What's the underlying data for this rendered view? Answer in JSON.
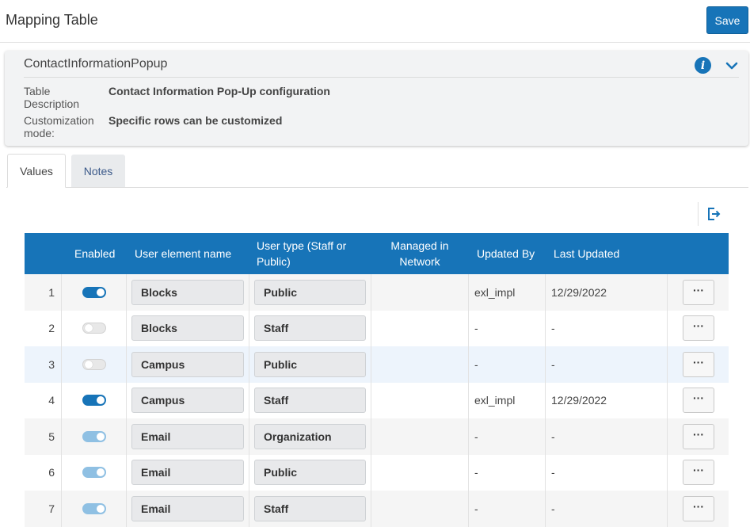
{
  "header": {
    "title": "Mapping Table",
    "save_label": "Save"
  },
  "panel": {
    "title": "ContactInformationPopup",
    "fields": [
      {
        "label": "Table Description",
        "value": "Contact Information Pop-Up configuration"
      },
      {
        "label": "Customization mode:",
        "value": "Specific rows can be customized"
      }
    ]
  },
  "tabs": [
    {
      "label": "Values",
      "active": true
    },
    {
      "label": "Notes",
      "active": false
    }
  ],
  "table": {
    "columns": {
      "enabled": "Enabled",
      "user_element_name": "User element name",
      "user_type": "User type (Staff or Public)",
      "managed_in_network": "Managed in Network",
      "updated_by": "Updated By",
      "last_updated": "Last Updated"
    },
    "rows": [
      {
        "num": "1",
        "enabled": "on",
        "element": "Blocks",
        "type": "Public",
        "managed": "",
        "updated_by": "exl_impl",
        "last_updated": "12/29/2022",
        "actions": "···"
      },
      {
        "num": "2",
        "enabled": "off",
        "element": "Blocks",
        "type": "Staff",
        "managed": "",
        "updated_by": "-",
        "last_updated": "-",
        "actions": "···"
      },
      {
        "num": "3",
        "enabled": "off",
        "element": "Campus",
        "type": "Public",
        "managed": "",
        "updated_by": "-",
        "last_updated": "-",
        "actions": "···"
      },
      {
        "num": "4",
        "enabled": "on",
        "element": "Campus",
        "type": "Staff",
        "managed": "",
        "updated_by": "exl_impl",
        "last_updated": "12/29/2022",
        "actions": "···"
      },
      {
        "num": "5",
        "enabled": "on-disabled",
        "element": "Email",
        "type": "Organization",
        "managed": "",
        "updated_by": "-",
        "last_updated": "-",
        "actions": "···"
      },
      {
        "num": "6",
        "enabled": "on-disabled",
        "element": "Email",
        "type": "Public",
        "managed": "",
        "updated_by": "-",
        "last_updated": "-",
        "actions": "···"
      },
      {
        "num": "7",
        "enabled": "on-disabled",
        "element": "Email",
        "type": "Staff",
        "managed": "",
        "updated_by": "-",
        "last_updated": "-",
        "actions": "···"
      }
    ]
  },
  "colors": {
    "accent": "#1774b8",
    "toggle_disabled": "#8fc0e3",
    "row_highlight": "#edf4fc"
  }
}
